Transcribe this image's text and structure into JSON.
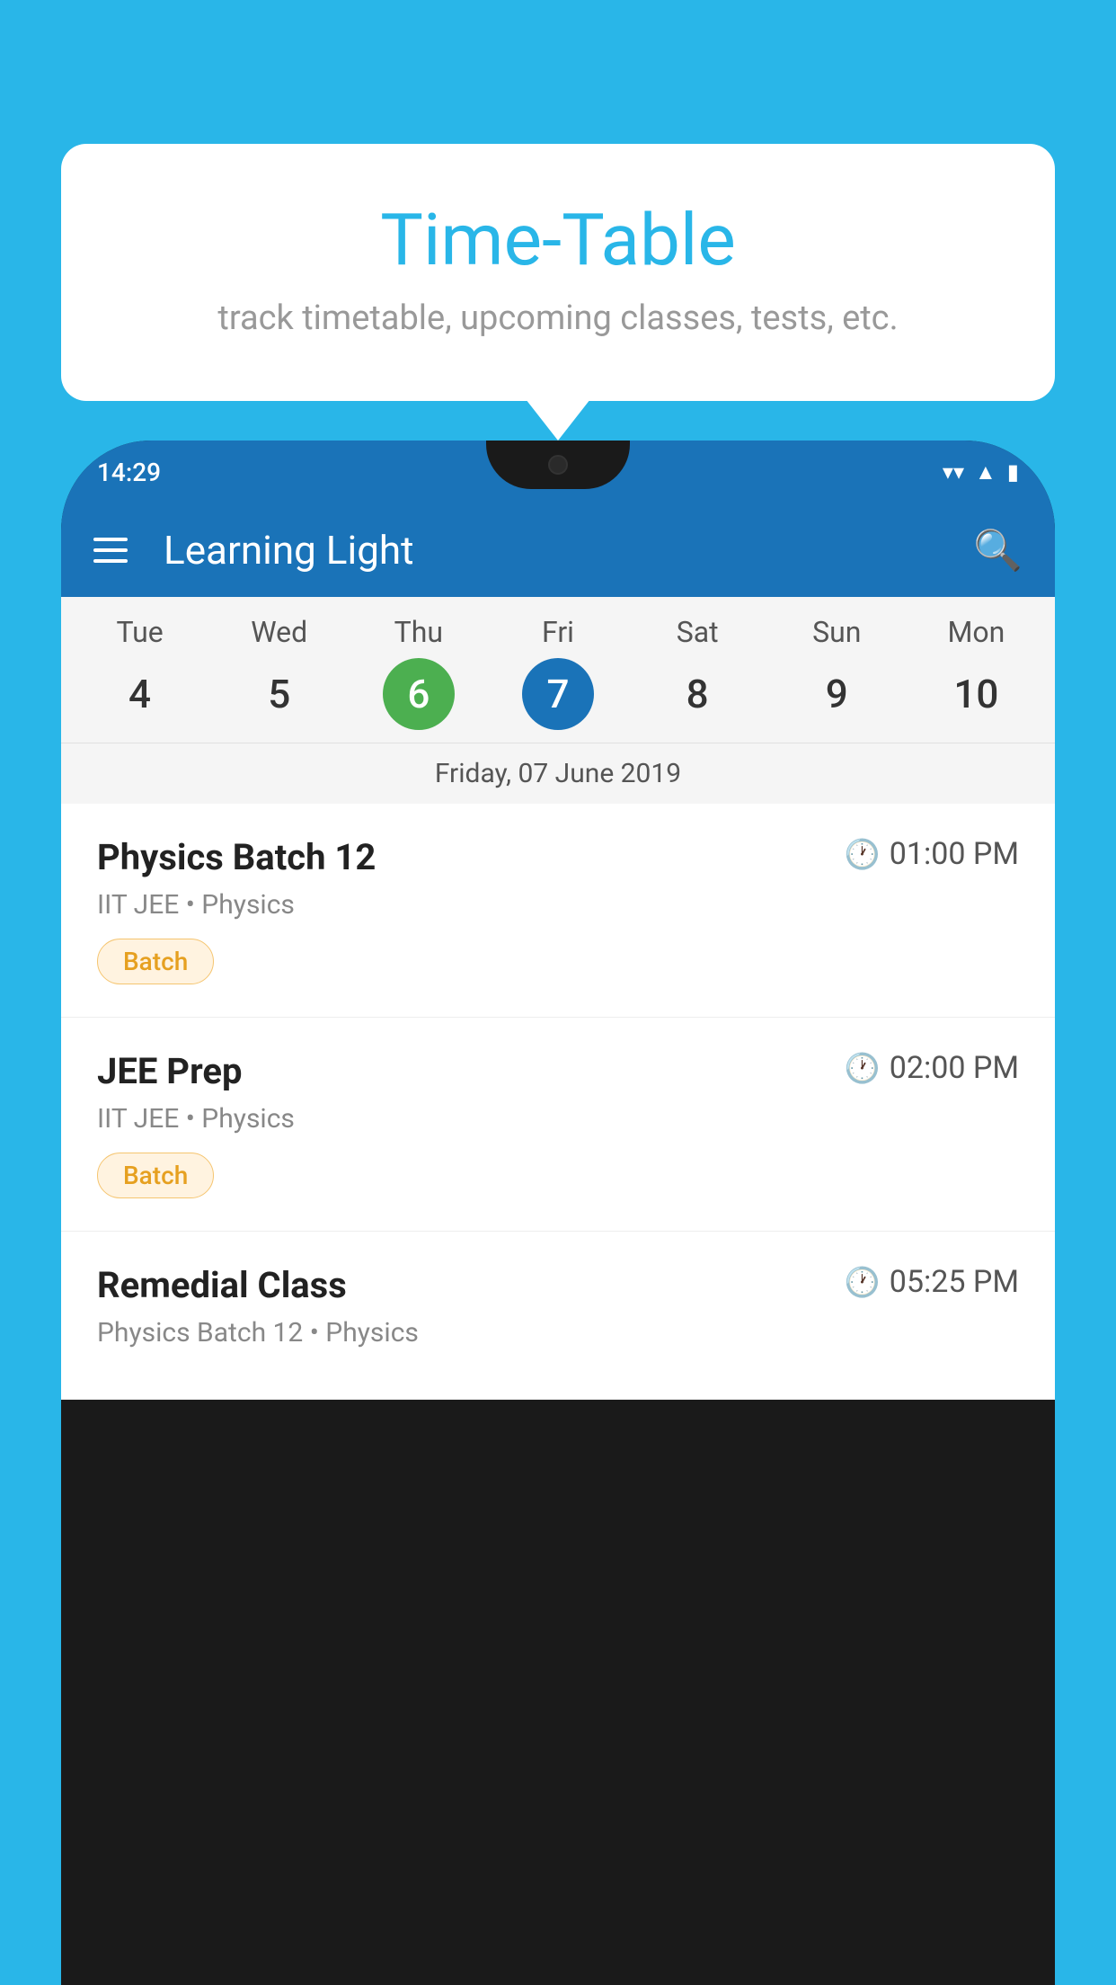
{
  "background_color": "#29b6e8",
  "tooltip": {
    "title": "Time-Table",
    "subtitle": "track timetable, upcoming classes, tests, etc."
  },
  "phone": {
    "status_bar": {
      "time": "14:29",
      "signal_wifi": "▲",
      "signal_mobile": "▲",
      "battery": "▮"
    },
    "app_bar": {
      "title": "Learning Light",
      "hamburger_label": "menu",
      "search_label": "search"
    },
    "calendar": {
      "days": [
        {
          "name": "Tue",
          "num": "4",
          "state": "normal"
        },
        {
          "name": "Wed",
          "num": "5",
          "state": "normal"
        },
        {
          "name": "Thu",
          "num": "6",
          "state": "today"
        },
        {
          "name": "Fri",
          "num": "7",
          "state": "selected"
        },
        {
          "name": "Sat",
          "num": "8",
          "state": "normal"
        },
        {
          "name": "Sun",
          "num": "9",
          "state": "normal"
        },
        {
          "name": "Mon",
          "num": "10",
          "state": "normal"
        }
      ],
      "selected_date_label": "Friday, 07 June 2019"
    },
    "classes": [
      {
        "name": "Physics Batch 12",
        "time": "01:00 PM",
        "meta": "IIT JEE • Physics",
        "tag": "Batch"
      },
      {
        "name": "JEE Prep",
        "time": "02:00 PM",
        "meta": "IIT JEE • Physics",
        "tag": "Batch"
      },
      {
        "name": "Remedial Class",
        "time": "05:25 PM",
        "meta": "Physics Batch 12 • Physics",
        "tag": ""
      }
    ]
  }
}
